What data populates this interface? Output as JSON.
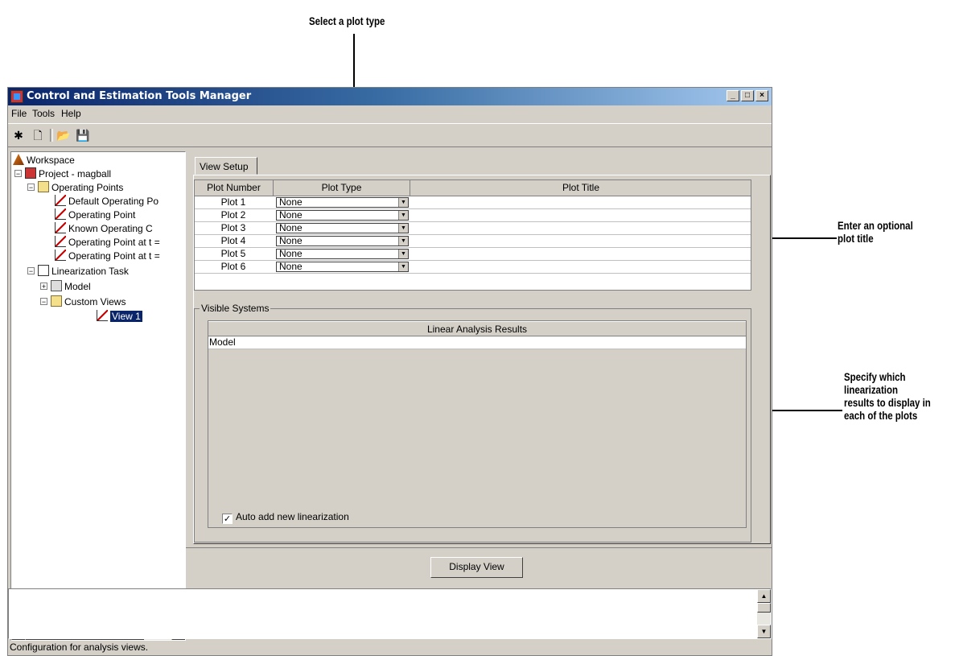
{
  "callouts": {
    "select_plot_type": "Select a plot type",
    "enter_title": [
      "Enter an optional",
      "plot title"
    ],
    "specify_results": [
      "Specify which",
      "linearization",
      "results to display in",
      "each of the plots"
    ]
  },
  "window": {
    "title": "Control and Estimation Tools Manager",
    "controls": {
      "minimize": "_",
      "maximize": "□",
      "close": "×"
    }
  },
  "menu": {
    "file": "File",
    "tools": "Tools",
    "help": "Help"
  },
  "toolbar": {
    "new_project_icon": "✱",
    "new_task_icon": "🗋",
    "open_icon": "📂",
    "save_icon": "💾"
  },
  "tree": {
    "workspace": "Workspace",
    "project": "Project - magball",
    "operating_points": "Operating Points",
    "op_items": [
      "Default Operating Po",
      "Operating Point",
      "Known Operating C",
      "Operating Point at t =",
      "Operating Point at t ="
    ],
    "linearization_task": "Linearization Task",
    "model": "Model",
    "custom_views": "Custom Views",
    "view1": "View 1"
  },
  "tab": {
    "label": "View Setup"
  },
  "plot_table": {
    "headers": [
      "Plot Number",
      "Plot Type",
      "Plot Title"
    ],
    "rows": [
      {
        "number": "Plot 1",
        "type": "None",
        "title": ""
      },
      {
        "number": "Plot 2",
        "type": "None",
        "title": ""
      },
      {
        "number": "Plot 3",
        "type": "None",
        "title": ""
      },
      {
        "number": "Plot 4",
        "type": "None",
        "title": ""
      },
      {
        "number": "Plot 5",
        "type": "None",
        "title": ""
      },
      {
        "number": "Plot 6",
        "type": "None",
        "title": ""
      }
    ]
  },
  "visible_systems": {
    "label": "Visible Systems",
    "header": "Linear Analysis Results",
    "rows": [
      "Model"
    ],
    "auto_add_label": "Auto add new linearization",
    "auto_add_checked": true
  },
  "display_button": "Display View",
  "status": "Configuration for analysis views."
}
